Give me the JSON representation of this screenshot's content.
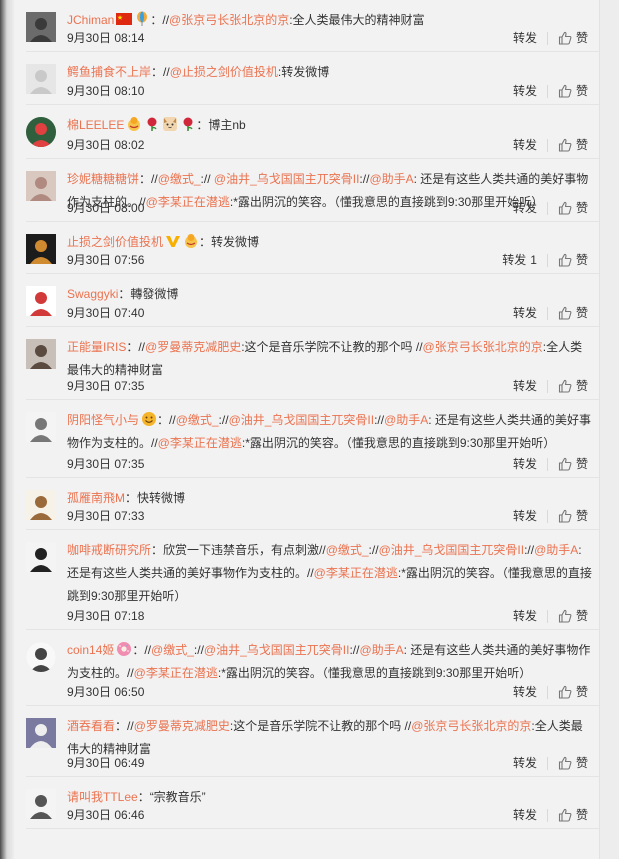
{
  "ui": {
    "repost_label": "转发",
    "like_label": "赞"
  },
  "comments": [
    {
      "user": "JChiman",
      "segments": [
        {
          "t": "：//"
        },
        {
          "t": "@张京弓长张北京的京",
          "m": true
        },
        {
          "t": ":全人类最伟大的精神财富"
        }
      ],
      "time": "9月30日 08:14",
      "repost_count": ""
    },
    {
      "user": "鳄鱼捕食不上岸",
      "segments": [
        {
          "t": "：//"
        },
        {
          "t": "@止损之剑价值投机",
          "m": true
        },
        {
          "t": ":转发微博"
        }
      ],
      "time": "9月30日 08:10",
      "repost_count": ""
    },
    {
      "user": "棉LEELEE",
      "segments": [
        {
          "t": "：博主nb"
        }
      ],
      "time": "9月30日 08:02",
      "repost_count": ""
    },
    {
      "user": "珍妮糖糖糖饼",
      "segments": [
        {
          "t": "：//"
        },
        {
          "t": "@缴式_",
          "m": true
        },
        {
          "t": ":// "
        },
        {
          "t": "@油井_乌戈国国主兀突骨II",
          "m": true
        },
        {
          "t": "://"
        },
        {
          "t": "@助手A",
          "m": true
        },
        {
          "t": ": 还是有这些人类共通的美好事物作为支柱的。//"
        },
        {
          "t": "@李某正在潜逃",
          "m": true
        },
        {
          "t": ":*露出阴沉的笑容。（懂我意思的直接跳到9:30那里开始听）"
        }
      ],
      "time": "9月30日 08:00",
      "repost_count": ""
    },
    {
      "user": "止损之剑价值投机",
      "segments": [
        {
          "t": "：转发微博"
        }
      ],
      "time": "9月30日 07:56",
      "repost_count": "1"
    },
    {
      "user": "Swaggyki",
      "segments": [
        {
          "t": "：轉發微博"
        }
      ],
      "time": "9月30日 07:40",
      "repost_count": ""
    },
    {
      "user": "正能量IRIS",
      "segments": [
        {
          "t": "：//"
        },
        {
          "t": "@罗曼蒂克减肥史",
          "m": true
        },
        {
          "t": ":这个是音乐学院不让教的那个吗 //"
        },
        {
          "t": "@张京弓长张北京的京",
          "m": true
        },
        {
          "t": ":全人类最伟大的精神财富"
        }
      ],
      "time": "9月30日 07:35",
      "repost_count": ""
    },
    {
      "user": "阴阳怪气小与",
      "segments": [
        {
          "t": "：//"
        },
        {
          "t": "@缴式_",
          "m": true
        },
        {
          "t": "://"
        },
        {
          "t": "@油井_乌戈国国主兀突骨II",
          "m": true
        },
        {
          "t": "://"
        },
        {
          "t": "@助手A",
          "m": true
        },
        {
          "t": ": 还是有这些人类共通的美好事物作为支柱的。//"
        },
        {
          "t": "@李某正在潜逃",
          "m": true
        },
        {
          "t": ":*露出阴沉的笑容。（懂我意思的直接跳到9:30那里开始听）"
        }
      ],
      "time": "9月30日 07:35",
      "repost_count": ""
    },
    {
      "user": "孤雁南飛M",
      "segments": [
        {
          "t": "：快转微博"
        }
      ],
      "time": "9月30日 07:33",
      "repost_count": ""
    },
    {
      "user": "咖啡戒断研究所",
      "segments": [
        {
          "t": "：欣赏一下违禁音乐，有点刺激//"
        },
        {
          "t": "@缴式_",
          "m": true
        },
        {
          "t": "://"
        },
        {
          "t": "@油井_乌戈国国主兀突骨II",
          "m": true
        },
        {
          "t": "://"
        },
        {
          "t": "@助手A",
          "m": true
        },
        {
          "t": ": 还是有这些人类共通的美好事物作为支柱的。//"
        },
        {
          "t": "@李某正在潜逃",
          "m": true
        },
        {
          "t": ":*露出阴沉的笑容。（懂我意思的直接跳到9:30那里开始听）"
        }
      ],
      "time": "9月30日 07:18",
      "repost_count": ""
    },
    {
      "user": "coin14姬",
      "segments": [
        {
          "t": "：//"
        },
        {
          "t": "@缴式_",
          "m": true
        },
        {
          "t": "://"
        },
        {
          "t": "@油井_乌戈国国主兀突骨II",
          "m": true
        },
        {
          "t": "://"
        },
        {
          "t": "@助手A",
          "m": true
        },
        {
          "t": ": 还是有这些人类共通的美好事物作为支柱的。//"
        },
        {
          "t": "@李某正在潜逃",
          "m": true
        },
        {
          "t": ":*露出阴沉的笑容。（懂我意思的直接跳到9:30那里开始听）"
        }
      ],
      "time": "9月30日 06:50",
      "repost_count": ""
    },
    {
      "user": "酒吞看看",
      "segments": [
        {
          "t": "：//"
        },
        {
          "t": "@罗曼蒂克减肥史",
          "m": true
        },
        {
          "t": ":这个是音乐学院不让教的那个吗 //"
        },
        {
          "t": "@张京弓长张北京的京",
          "m": true
        },
        {
          "t": ":全人类最伟大的精神财富"
        }
      ],
      "time": "9月30日 06:49",
      "repost_count": ""
    },
    {
      "user": "请叫我TTLee",
      "segments": [
        {
          "t": "：“宗教音乐”"
        }
      ],
      "time": "9月30日 06:46",
      "repost_count": ""
    }
  ],
  "colors": {
    "name": "#eb7350",
    "text": "#333333",
    "separator": "#e4e4e4",
    "background": "#f2f2f2"
  },
  "badges": {
    "JChiman": [
      "china-flag-icon",
      "balloon-icon"
    ],
    "棉LEELEE": [
      "bowing-icon",
      "rose-icon",
      "cat-face-icon",
      "rose-icon"
    ],
    "止损之剑价值投机": [
      "verified-v-icon",
      "bowing-icon"
    ],
    "阴阳怪气小与": [
      "smile-icon"
    ],
    "coin14姬": [
      "donut-icon"
    ]
  }
}
